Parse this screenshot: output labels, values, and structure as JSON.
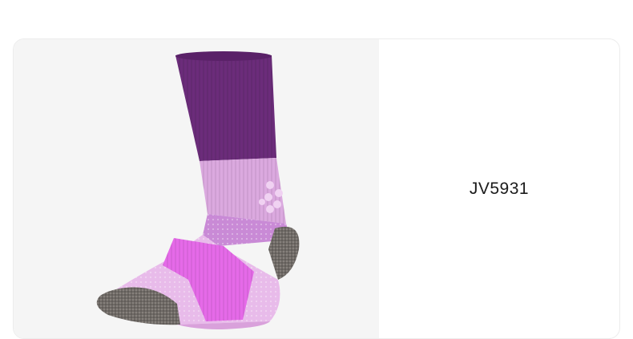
{
  "product": {
    "sku": "JV5931",
    "image_icon": "sock-product-image",
    "colors": {
      "cuff": "#6b2c7a",
      "upper": "#d9a9df",
      "mid": "#c87fd8",
      "accent": "#e66ae8",
      "foot": "#e8b9ea",
      "heel_toe": "#6f6a66"
    }
  }
}
